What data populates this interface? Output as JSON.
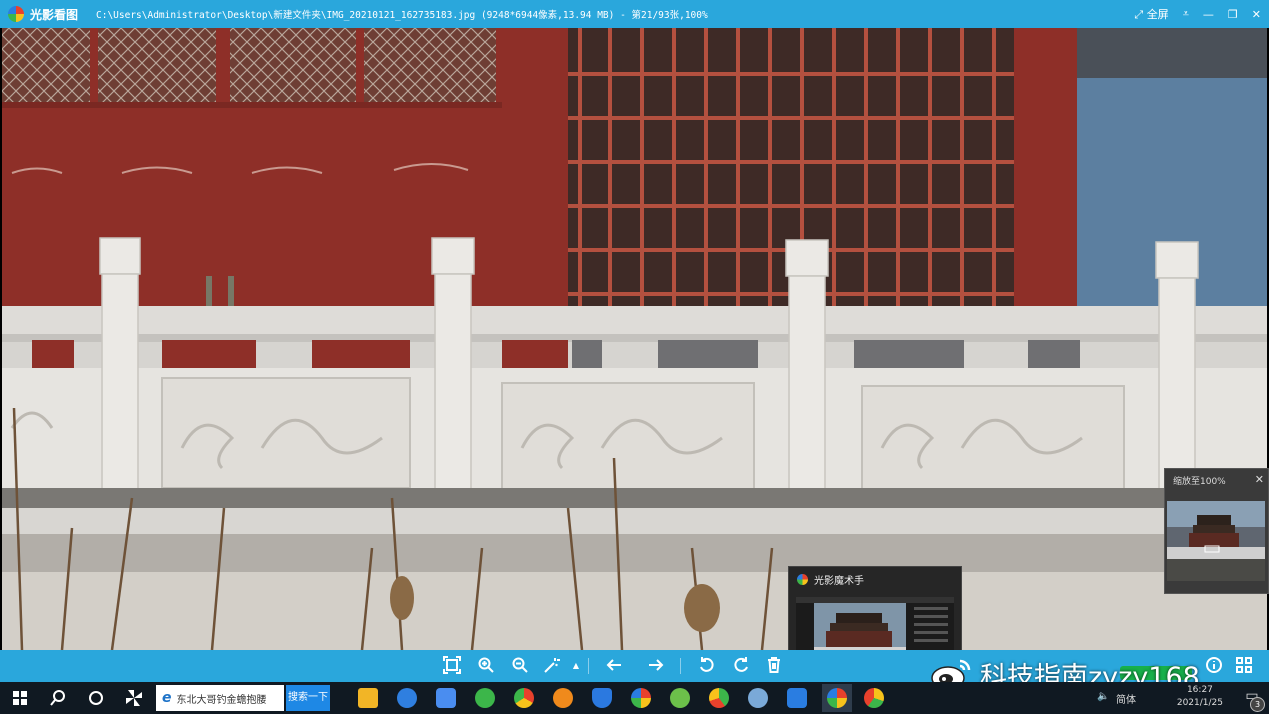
{
  "titlebar": {
    "app_name": "光影看图",
    "file_path": "C:\\Users\\Administrator\\Desktop\\新建文件夹\\IMG_20210121_162735183.jpg (9248*6944像素,13.94 MB) - 第21/93张,100%",
    "fullscreen_label": "全屏",
    "menu_icon": "menu-down-icon",
    "minimize_icon": "minimize-icon",
    "restore_icon": "restore-icon",
    "close_icon": "close-icon"
  },
  "zoom_panel": {
    "label": "缩放至100%",
    "close": "✕"
  },
  "preview": {
    "title": "光影魔术手"
  },
  "toolbar": {
    "icons": [
      "fit-screen-icon",
      "zoom-in-icon",
      "zoom-out-icon",
      "magic-wand-icon",
      "dropdown-icon",
      "previous-arrow-icon",
      "next-arrow-icon",
      "rotate-left-icon",
      "rotate-right-icon",
      "delete-icon",
      "info-icon",
      "grid-view-icon"
    ]
  },
  "watermark": {
    "text": "科技指南zyzy168"
  },
  "taskbar": {
    "search_text": "东北大哥钓金蟾抱腰",
    "search_button": "搜索一下",
    "ime": "简体",
    "time": "16:27",
    "date": "2021/1/25",
    "notification_count": "3"
  },
  "colors": {
    "accent": "#2aa7dc",
    "taskbar": "#101922",
    "wall": "#8f3029"
  }
}
